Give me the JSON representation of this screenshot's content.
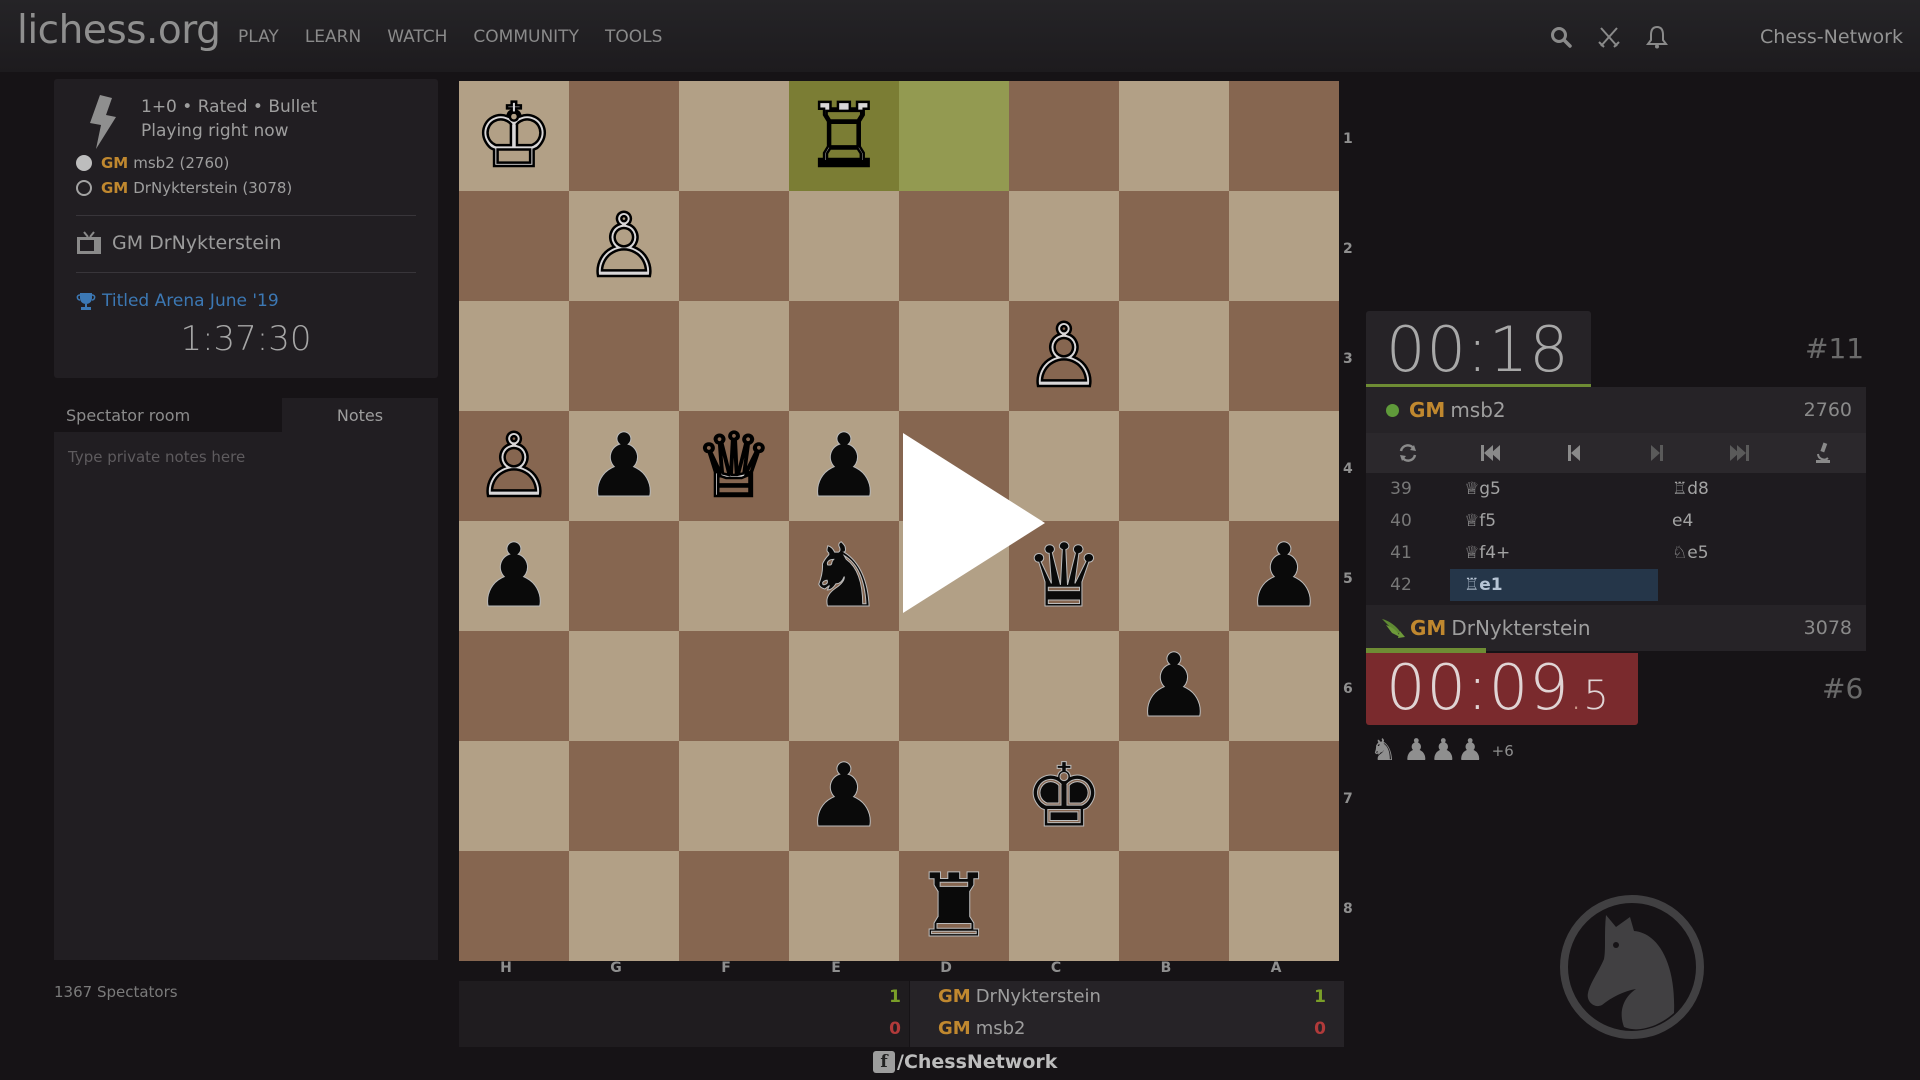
{
  "header": {
    "logo": "lichess.org",
    "nav": [
      "PLAY",
      "LEARN",
      "WATCH",
      "COMMUNITY",
      "TOOLS"
    ],
    "icons": [
      "search-icon",
      "crossed-swords-icon",
      "bell-icon"
    ],
    "user": "Chess-Network"
  },
  "game_info": {
    "icon": "lightning-bolt-icon",
    "line1": "1+0 • Rated • Bullet",
    "line2": "Playing right now",
    "players": [
      {
        "color": "white",
        "title": "GM",
        "name": "msb2 (2760)"
      },
      {
        "color": "black",
        "title": "GM",
        "name": "DrNykterstein (3078)"
      }
    ],
    "tv_label": "GM DrNykterstein",
    "tournament": "Titled Arena June '19",
    "tournament_clock": "1:37:30"
  },
  "chat": {
    "tabs": [
      "Spectator room",
      "Notes"
    ],
    "active_tab": "Notes",
    "notes_placeholder": "Type private notes here",
    "spectators": "1367 Spectators"
  },
  "board": {
    "orientation": "black",
    "files": [
      "H",
      "G",
      "F",
      "E",
      "D",
      "C",
      "B",
      "A"
    ],
    "ranks": [
      "1",
      "2",
      "3",
      "4",
      "5",
      "6",
      "7",
      "8"
    ],
    "last_move": {
      "from": "e1",
      "to": "d1"
    },
    "pieces": [
      {
        "sq": "h1",
        "color": "w",
        "type": "K"
      },
      {
        "sq": "e1",
        "color": "w",
        "type": "R"
      },
      {
        "sq": "g2",
        "color": "w",
        "type": "P"
      },
      {
        "sq": "c3",
        "color": "w",
        "type": "P"
      },
      {
        "sq": "h4",
        "color": "w",
        "type": "P"
      },
      {
        "sq": "g4",
        "color": "b",
        "type": "P"
      },
      {
        "sq": "f4",
        "color": "w",
        "type": "Q"
      },
      {
        "sq": "e4",
        "color": "b",
        "type": "P"
      },
      {
        "sq": "h5",
        "color": "b",
        "type": "P"
      },
      {
        "sq": "e5",
        "color": "b",
        "type": "N"
      },
      {
        "sq": "c5",
        "color": "b",
        "type": "Q"
      },
      {
        "sq": "a5",
        "color": "b",
        "type": "P"
      },
      {
        "sq": "b6",
        "color": "b",
        "type": "P"
      },
      {
        "sq": "e7",
        "color": "b",
        "type": "P"
      },
      {
        "sq": "c7",
        "color": "b",
        "type": "K"
      },
      {
        "sq": "d8",
        "color": "b",
        "type": "R"
      }
    ],
    "overlay": "play-video-icon"
  },
  "scoreboard": {
    "rows": [
      {
        "title": "GM",
        "name": "DrNykterstein",
        "left_score": "1",
        "right_score": "1",
        "status": "win"
      },
      {
        "title": "GM",
        "name": "msb2",
        "left_score": "0",
        "right_score": "0",
        "status": "lose"
      }
    ],
    "facebook": "/ChessNetwork"
  },
  "right_panel": {
    "top_clock": "00:18",
    "top_clock_bar_fraction": 0.45,
    "top_rank": "#11",
    "top_player": {
      "title": "GM",
      "name": "msb2",
      "rating": "2760",
      "status": "online"
    },
    "controls": [
      "flip-board-icon",
      "first-move-icon",
      "prev-move-icon",
      "next-move-icon",
      "last-move-icon",
      "analysis-icon"
    ],
    "moves": [
      {
        "num": "39",
        "white": "♕g5",
        "black": "♖d8"
      },
      {
        "num": "40",
        "white": "♕f5",
        "black": "e4"
      },
      {
        "num": "41",
        "white": "♕f4+",
        "black": "♘e5"
      },
      {
        "num": "42",
        "white": "♖e1",
        "black": ""
      }
    ],
    "active_move": "42.white",
    "bottom_player": {
      "title": "GM",
      "name": "DrNykterstein",
      "rating": "3078",
      "status": "patron-wings"
    },
    "bottom_clock_main": "00:09",
    "bottom_clock_tenths": "5",
    "bottom_clock_bar_fraction": 0.24,
    "bottom_rank": "#6",
    "material": {
      "pieces": [
        "♞",
        "♟",
        "♟",
        "♟"
      ],
      "diff": "+6"
    }
  },
  "colors": {
    "board_light": "#b2a086",
    "board_dark": "#866650",
    "last_move_from": "#7b7d34",
    "last_move_to": "#939a51",
    "title_gold": "#c0882f",
    "tournament_blue": "#3c78b4",
    "clock_low_red": "#7a2a2d",
    "clock_bar_green": "#6e8c34",
    "active_move_bg": "#253649"
  }
}
